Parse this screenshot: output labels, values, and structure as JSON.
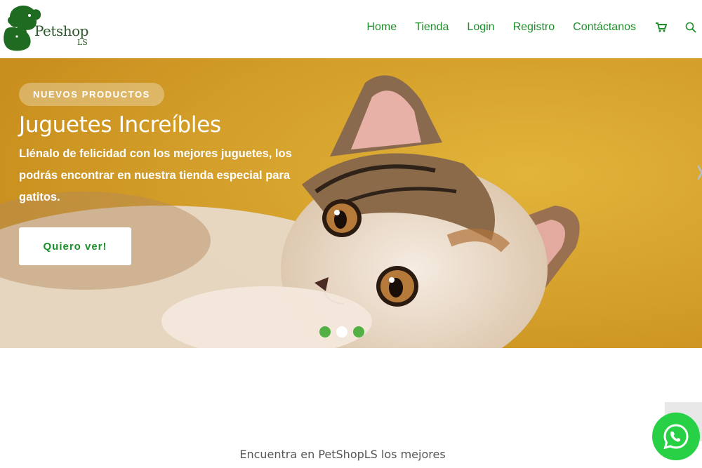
{
  "brand": {
    "name": "Petshop",
    "sub": "LS"
  },
  "nav": {
    "items": [
      {
        "label": "Home"
      },
      {
        "label": "Tienda"
      },
      {
        "label": "Login"
      },
      {
        "label": "Registro"
      },
      {
        "label": "Contáctanos"
      }
    ],
    "icons": [
      "cart-icon",
      "search-icon"
    ]
  },
  "hero": {
    "badge": "NUEVOS PRODUCTOS",
    "title": "Juguetes Increíbles",
    "description": "Llénalo de felicidad con los mejores juguetes, los podrás encontrar en nuestra tienda especial para gatitos.",
    "cta_label": "Quiero ver!",
    "slides": 3,
    "active_slide": 2
  },
  "section": {
    "intro": "Encuentra en PetShopLS los mejores"
  },
  "colors": {
    "accent": "#1c8f2a",
    "dot": "#52b044",
    "whatsapp": "#27d045",
    "hero_bg": "#d9a428"
  }
}
